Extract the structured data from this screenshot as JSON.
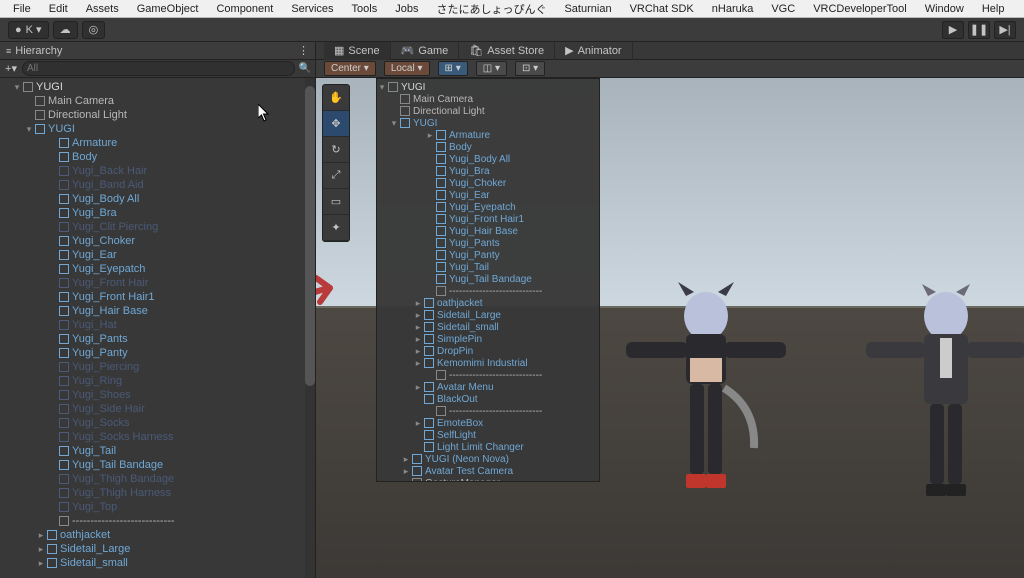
{
  "menu": [
    "File",
    "Edit",
    "Assets",
    "GameObject",
    "Component",
    "Services",
    "Tools",
    "Jobs",
    "さたにあしょっぴんぐ",
    "Saturnian",
    "VRChat SDK",
    "nHaruka",
    "VGC",
    "VRCDeveloperTool",
    "Window",
    "Help"
  ],
  "toolbar": {
    "account": "K ▾"
  },
  "play": {
    "play": "▶",
    "pause": "❚❚",
    "step": "▶|"
  },
  "hierarchy": {
    "title": "Hierarchy",
    "search_placeholder": "All",
    "root": "YUGI",
    "root_children": [
      "Main Camera",
      "Directional Light"
    ],
    "yugi_node": "YUGI",
    "items": [
      {
        "l": "Armature",
        "c": "blue",
        "i": 4
      },
      {
        "l": "Body",
        "c": "blue",
        "i": 4
      },
      {
        "l": "Yugi_Back Hair",
        "c": "dim",
        "i": 4
      },
      {
        "l": "Yugi_Band Aid",
        "c": "dim",
        "i": 4
      },
      {
        "l": "Yugi_Body All",
        "c": "blue",
        "i": 4
      },
      {
        "l": "Yugi_Bra",
        "c": "blue",
        "i": 4
      },
      {
        "l": "Yugi_Clit Piercing",
        "c": "dim",
        "i": 4
      },
      {
        "l": "Yugi_Choker",
        "c": "blue",
        "i": 4
      },
      {
        "l": "Yugi_Ear",
        "c": "blue",
        "i": 4
      },
      {
        "l": "Yugi_Eyepatch",
        "c": "blue",
        "i": 4
      },
      {
        "l": "Yugi_Front Hair",
        "c": "dim",
        "i": 4
      },
      {
        "l": "Yugi_Front Hair1",
        "c": "blue",
        "i": 4
      },
      {
        "l": "Yugi_Hair Base",
        "c": "blue",
        "i": 4
      },
      {
        "l": "Yugi_Hat",
        "c": "dim",
        "i": 4
      },
      {
        "l": "Yugi_Pants",
        "c": "blue",
        "i": 4
      },
      {
        "l": "Yugi_Panty",
        "c": "blue",
        "i": 4
      },
      {
        "l": "Yugi_Piercing",
        "c": "dim",
        "i": 4
      },
      {
        "l": "Yugi_Ring",
        "c": "dim",
        "i": 4
      },
      {
        "l": "Yugi_Shoes",
        "c": "dim",
        "i": 4
      },
      {
        "l": "Yugi_Side Hair",
        "c": "dim",
        "i": 4
      },
      {
        "l": "Yugi_Socks",
        "c": "dim",
        "i": 4
      },
      {
        "l": "Yugi_Socks Harness",
        "c": "dim",
        "i": 4
      },
      {
        "l": "Yugi_Tail",
        "c": "blue",
        "i": 4
      },
      {
        "l": "Yugi_Tail Bandage",
        "c": "blue",
        "i": 4
      },
      {
        "l": "Yugi_Thigh Bandage",
        "c": "dim",
        "i": 4
      },
      {
        "l": "Yugi_Thigh Harness",
        "c": "dim",
        "i": 4
      },
      {
        "l": "Yugi_Top",
        "c": "dim",
        "i": 4
      },
      {
        "l": "----------------------------",
        "c": "gray",
        "i": 4
      },
      {
        "l": "oathjacket",
        "c": "blue",
        "i": 3,
        "caret": "▸"
      },
      {
        "l": "Sidetail_Large",
        "c": "blue",
        "i": 3,
        "caret": "▸"
      },
      {
        "l": "Sidetail_small",
        "c": "blue",
        "i": 3,
        "caret": "▸"
      }
    ]
  },
  "tabs": {
    "scene": "Scene",
    "game": "Game",
    "asset": "Asset Store",
    "anim": "Animator"
  },
  "scene_toolbar": {
    "pivot": "Center ▾",
    "space": "Local ▾"
  },
  "popup": {
    "root": "YUGI",
    "root_children": [
      "Main Camera",
      "Directional Light"
    ],
    "yugi": "YUGI",
    "items": [
      {
        "l": "Armature",
        "c": "blue",
        "i": 4,
        "caret": "▸"
      },
      {
        "l": "Body",
        "c": "blue",
        "i": 4
      },
      {
        "l": "Yugi_Body All",
        "c": "blue",
        "i": 4
      },
      {
        "l": "Yugi_Bra",
        "c": "blue",
        "i": 4
      },
      {
        "l": "Yugi_Choker",
        "c": "blue",
        "i": 4
      },
      {
        "l": "Yugi_Ear",
        "c": "blue",
        "i": 4
      },
      {
        "l": "Yugi_Eyepatch",
        "c": "blue",
        "i": 4
      },
      {
        "l": "Yugi_Front Hair1",
        "c": "blue",
        "i": 4
      },
      {
        "l": "Yugi_Hair Base",
        "c": "blue",
        "i": 4
      },
      {
        "l": "Yugi_Pants",
        "c": "blue",
        "i": 4
      },
      {
        "l": "Yugi_Panty",
        "c": "blue",
        "i": 4
      },
      {
        "l": "Yugi_Tail",
        "c": "blue",
        "i": 4
      },
      {
        "l": "Yugi_Tail Bandage",
        "c": "blue",
        "i": 4
      },
      {
        "l": "----------------------------",
        "c": "gray",
        "i": 4
      },
      {
        "l": "oathjacket",
        "c": "blue",
        "i": 3,
        "caret": "▸"
      },
      {
        "l": "Sidetail_Large",
        "c": "blue",
        "i": 3,
        "caret": "▸"
      },
      {
        "l": "Sidetail_small",
        "c": "blue",
        "i": 3,
        "caret": "▸"
      },
      {
        "l": "SimplePin",
        "c": "blue",
        "i": 3,
        "caret": "▸"
      },
      {
        "l": "DropPin",
        "c": "blue",
        "i": 3,
        "caret": "▸"
      },
      {
        "l": "Kemomimi Industrial",
        "c": "blue",
        "i": 3,
        "caret": "▸"
      },
      {
        "l": "----------------------------",
        "c": "gray",
        "i": 4
      },
      {
        "l": "Avatar Menu",
        "c": "blue",
        "i": 3,
        "caret": "▸"
      },
      {
        "l": "BlackOut",
        "c": "blue",
        "i": 3
      },
      {
        "l": "----------------------------",
        "c": "gray",
        "i": 4
      },
      {
        "l": "EmoteBox",
        "c": "blue",
        "i": 3,
        "caret": "▸"
      },
      {
        "l": "SelfLight",
        "c": "blue",
        "i": 3
      },
      {
        "l": "Light Limit Changer",
        "c": "blue",
        "i": 3
      },
      {
        "l": "YUGI (Neon Nova)",
        "c": "blue",
        "i": 2,
        "caret": "▸"
      },
      {
        "l": "Avatar Test Camera",
        "c": "blue",
        "i": 2,
        "caret": "▸"
      },
      {
        "l": "GestureManager",
        "c": "gray",
        "i": 2
      }
    ]
  }
}
